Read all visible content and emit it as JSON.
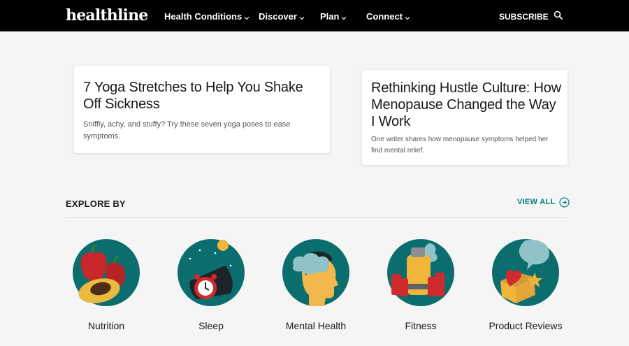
{
  "header": {
    "logo": "healthline",
    "nav": [
      "Health Conditions",
      "Discover",
      "Plan",
      "Connect"
    ],
    "subscribe": "SUBSCRIBE",
    "search_icon": "search-icon"
  },
  "articles": [
    {
      "title": "7 Yoga Stretches to Help You Shake Off Sickness",
      "description": "Sniffly, achy, and stuffy? Try these seven yoga poses to ease symptoms."
    },
    {
      "title": "Rethinking Hustle Culture: How Menopause Changed the Way I Work",
      "description": "One writer shares how menopause symptoms helped her find mental relief."
    }
  ],
  "explore": {
    "heading": "EXPLORE BY",
    "view_all": "VIEW ALL",
    "topics": [
      {
        "label": "Nutrition",
        "icon": "nutrition-icon"
      },
      {
        "label": "Sleep",
        "icon": "sleep-icon"
      },
      {
        "label": "Mental Health",
        "icon": "mental-health-icon"
      },
      {
        "label": "Fitness",
        "icon": "fitness-icon"
      },
      {
        "label": "Product Reviews",
        "icon": "product-reviews-icon"
      }
    ]
  },
  "colors": {
    "brand_teal": "#008080",
    "icon_circle": "#0b6d6d",
    "header_bg": "#000000",
    "page_bg": "#f5f5f5"
  }
}
